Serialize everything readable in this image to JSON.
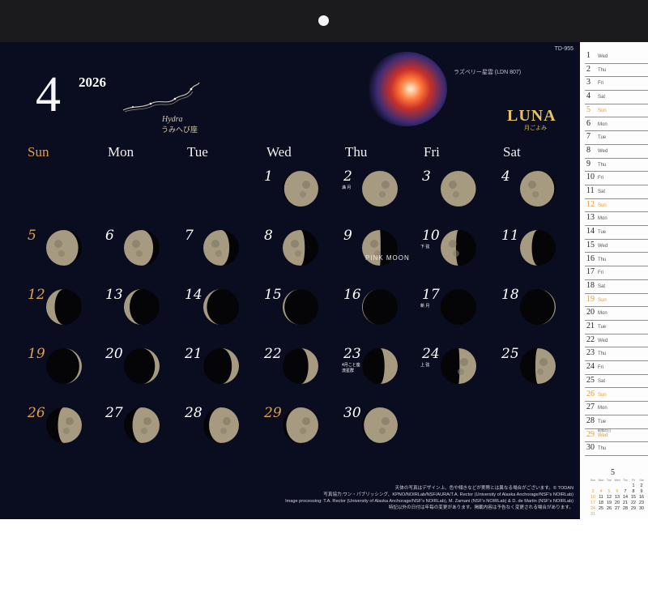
{
  "calendar": {
    "month": "4",
    "year": "2026",
    "code": "TD-955",
    "constellation": {
      "name_en": "Hydra",
      "name_ja": "うみへび座"
    },
    "nebula_label": "ラズベリー星雲 (LDN 807)",
    "brand": {
      "title": "LUNA",
      "subtitle": "月ごよみ"
    },
    "weekdays": [
      "Sun",
      "Mon",
      "Tue",
      "Wed",
      "Thu",
      "Fri",
      "Sat"
    ],
    "special_label": "PINK MOON",
    "days": [
      {
        "day": "1",
        "phase": 0.96,
        "waxing": true
      },
      {
        "day": "2",
        "phase": 1.0,
        "waxing": true,
        "note": "満 月"
      },
      {
        "day": "3",
        "phase": 0.99,
        "waxing": false
      },
      {
        "day": "4",
        "phase": 0.96,
        "waxing": false
      },
      {
        "day": "5",
        "phase": 0.9,
        "waxing": false,
        "orange": true
      },
      {
        "day": "6",
        "phase": 0.82,
        "waxing": false
      },
      {
        "day": "7",
        "phase": 0.73,
        "waxing": false
      },
      {
        "day": "8",
        "phase": 0.62,
        "waxing": false
      },
      {
        "day": "9",
        "phase": 0.52,
        "waxing": false
      },
      {
        "day": "10",
        "phase": 0.43,
        "waxing": false,
        "note": "下 弦"
      },
      {
        "day": "11",
        "phase": 0.33,
        "waxing": false
      },
      {
        "day": "12",
        "phase": 0.24,
        "waxing": false,
        "orange": true
      },
      {
        "day": "13",
        "phase": 0.16,
        "waxing": false
      },
      {
        "day": "14",
        "phase": 0.1,
        "waxing": false
      },
      {
        "day": "15",
        "phase": 0.05,
        "waxing": false
      },
      {
        "day": "16",
        "phase": 0.02,
        "waxing": false
      },
      {
        "day": "17",
        "phase": 0.0,
        "waxing": true,
        "note": "新 月"
      },
      {
        "day": "18",
        "phase": 0.03,
        "waxing": true
      },
      {
        "day": "19",
        "phase": 0.07,
        "waxing": true,
        "orange": true
      },
      {
        "day": "20",
        "phase": 0.13,
        "waxing": true
      },
      {
        "day": "21",
        "phase": 0.2,
        "waxing": true
      },
      {
        "day": "22",
        "phase": 0.28,
        "waxing": true
      },
      {
        "day": "23",
        "phase": 0.37,
        "waxing": true,
        "note": "4月こと座\n流星群"
      },
      {
        "day": "24",
        "phase": 0.47,
        "waxing": true,
        "note": "上 弦"
      },
      {
        "day": "25",
        "phase": 0.57,
        "waxing": true
      },
      {
        "day": "26",
        "phase": 0.67,
        "waxing": true,
        "orange": true
      },
      {
        "day": "27",
        "phase": 0.76,
        "waxing": true
      },
      {
        "day": "28",
        "phase": 0.84,
        "waxing": true
      },
      {
        "day": "29",
        "phase": 0.9,
        "waxing": true,
        "orange": true
      },
      {
        "day": "30",
        "phase": 0.95,
        "waxing": true
      }
    ],
    "credits": [
      "天体の写真はデザイン上、色や傾きなどが実際とは異なる場合がございます。© TODAN",
      "写真協力:ワン・パブリッシング、KPNO/NOIRLab/NSF/AURA/T.A. Rector (University of Alaska Anchorage/NSF's NOIRLab)",
      "Image processing: T.A. Rector (University of Alaska Anchorage/NSF's NOIRLab), M. Zamani (NSF's NOIRLab) & D. de Martin (NSF's NOIRLab)",
      "特記以外の日付は年毎の変更があります。掲載内容は予告なく変更される場合があります。"
    ]
  },
  "sidebar": {
    "rows": [
      {
        "d": "1",
        "w": "Wed"
      },
      {
        "d": "2",
        "w": "Thu"
      },
      {
        "d": "3",
        "w": "Fri"
      },
      {
        "d": "4",
        "w": "Sat"
      },
      {
        "d": "5",
        "w": "Sun",
        "orange": true
      },
      {
        "d": "6",
        "w": "Mon"
      },
      {
        "d": "7",
        "w": "Tue"
      },
      {
        "d": "8",
        "w": "Wed"
      },
      {
        "d": "9",
        "w": "Thu"
      },
      {
        "d": "10",
        "w": "Fri"
      },
      {
        "d": "11",
        "w": "Sat"
      },
      {
        "d": "12",
        "w": "Sun",
        "orange": true
      },
      {
        "d": "13",
        "w": "Mon"
      },
      {
        "d": "14",
        "w": "Tue"
      },
      {
        "d": "15",
        "w": "Wed"
      },
      {
        "d": "16",
        "w": "Thu"
      },
      {
        "d": "17",
        "w": "Fri"
      },
      {
        "d": "18",
        "w": "Sat"
      },
      {
        "d": "19",
        "w": "Sun",
        "orange": true
      },
      {
        "d": "20",
        "w": "Mon"
      },
      {
        "d": "21",
        "w": "Tue"
      },
      {
        "d": "22",
        "w": "Wed"
      },
      {
        "d": "23",
        "w": "Thu"
      },
      {
        "d": "24",
        "w": "Fri"
      },
      {
        "d": "25",
        "w": "Sat"
      },
      {
        "d": "26",
        "w": "Sun",
        "orange": true
      },
      {
        "d": "27",
        "w": "Mon"
      },
      {
        "d": "28",
        "w": "Tue"
      },
      {
        "d": "29",
        "w": "Wed",
        "orange": true,
        "event": "昭和の日"
      },
      {
        "d": "30",
        "w": "Thu"
      }
    ],
    "next_month": {
      "title": "5",
      "headers": [
        "Sun",
        "Mon",
        "Tue",
        "Wed",
        "Thu",
        "Fri",
        "Sat"
      ],
      "weeks": [
        [
          "",
          "",
          "",
          "",
          "",
          "1",
          "2"
        ],
        [
          "3",
          "4",
          "5",
          "6",
          "7",
          "8",
          "9"
        ],
        [
          "10",
          "11",
          "12",
          "13",
          "14",
          "15",
          "16"
        ],
        [
          "17",
          "18",
          "19",
          "20",
          "21",
          "22",
          "23"
        ],
        [
          "24",
          "25",
          "26",
          "27",
          "28",
          "29",
          "30"
        ],
        [
          "31",
          "",
          "",
          "",
          "",
          "",
          ""
        ]
      ],
      "orange_days": [
        "3",
        "4",
        "5",
        "6",
        "10",
        "17",
        "24",
        "31"
      ]
    }
  }
}
